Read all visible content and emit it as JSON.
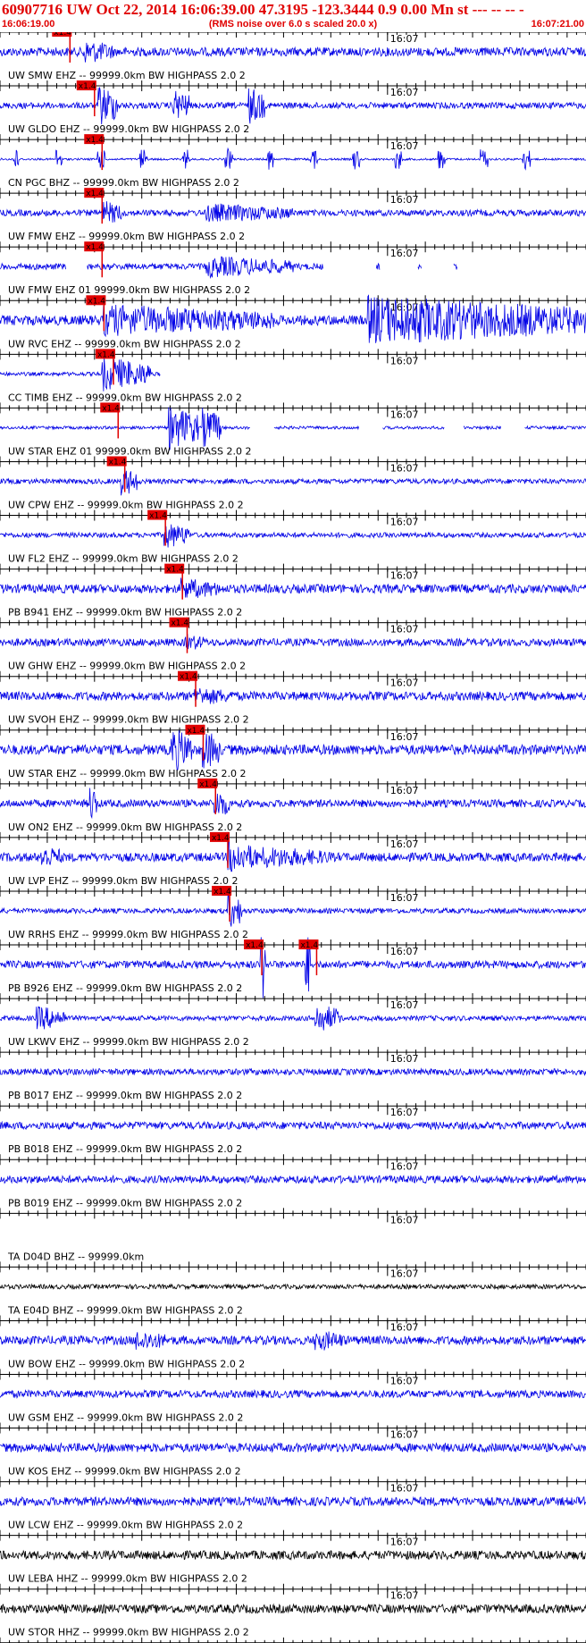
{
  "header": {
    "title": "60907716 UW Oct 22, 2014 16:06:39.00   47.3195 -123.3444  0.9 0.00 Mn st --- -- --  -",
    "start_time": "16:06:19.00",
    "note": "(RMS noise over 6.0 s scaled 20.0 x)",
    "end_time": "16:07:21.00"
  },
  "chart_data": {
    "type": "line",
    "title": "60907716 UW Oct 22, 2014 16:06:39.00   47.3195 -123.3444  0.9 0.00 Mn st --- -- --  -",
    "time_range": [
      "16:06:19.00",
      "16:07:21.00"
    ],
    "minute_tick_label": "16:07",
    "minute_tick_time_s": 41,
    "pick_label": "x1.4",
    "colors": {
      "trace": "#0000e6",
      "trace_alt": "#000000",
      "pick": "#e00000",
      "header": "#e00000"
    },
    "traces": [
      {
        "label": "UW SMW EHZ -- 99999.0km BW  HIGHPASS  2.0  2",
        "color": "#0000e6",
        "amp": 0.35,
        "picks": [
          {
            "t": 7.4
          }
        ],
        "bursts": [
          {
            "t": 9.0,
            "dur": 3,
            "amp": 1.0
          }
        ]
      },
      {
        "label": "UW GLDO EHZ -- 99999.0km BW  HIGHPASS  2.0  2",
        "color": "#0000e6",
        "amp": 0.25,
        "picks": [
          {
            "t": 10.0
          }
        ],
        "bursts": [
          {
            "t": 10.5,
            "dur": 2,
            "amp": 1.7
          },
          {
            "t": 18.5,
            "dur": 1.5,
            "amp": 1.3
          },
          {
            "t": 26.5,
            "dur": 1.5,
            "amp": 1.5
          }
        ]
      },
      {
        "label": "CN PGC BHZ -- 99999.0km BW  HIGHPASS  2.0  2",
        "color": "#0000e6",
        "amp": 0.08,
        "picks": [
          {
            "t": 10.8
          }
        ],
        "bursts": [
          {
            "t": 1.5,
            "dur": 0.6,
            "amp": 0.9
          },
          {
            "t": 6,
            "dur": 0.6,
            "amp": 0.9
          },
          {
            "t": 10.5,
            "dur": 0.6,
            "amp": 0.9
          },
          {
            "t": 15,
            "dur": 0.6,
            "amp": 0.9
          },
          {
            "t": 19.5,
            "dur": 0.6,
            "amp": 0.9
          },
          {
            "t": 24,
            "dur": 0.6,
            "amp": 0.9
          },
          {
            "t": 28.5,
            "dur": 0.6,
            "amp": 0.9
          },
          {
            "t": 33,
            "dur": 0.6,
            "amp": 0.9
          },
          {
            "t": 37.5,
            "dur": 0.6,
            "amp": 0.9
          },
          {
            "t": 42,
            "dur": 0.6,
            "amp": 0.9
          },
          {
            "t": 46.5,
            "dur": 0.6,
            "amp": 0.9
          },
          {
            "t": 51,
            "dur": 0.6,
            "amp": 0.9
          },
          {
            "t": 55.5,
            "dur": 0.6,
            "amp": 0.9
          }
        ]
      },
      {
        "label": "UW FMW EHZ -- 99999.0km BW  HIGHPASS  2.0  2",
        "color": "#0000e6",
        "amp": 0.25,
        "picks": [
          {
            "t": 10.8
          }
        ],
        "bursts": [
          {
            "t": 11,
            "dur": 2,
            "amp": 1.0
          },
          {
            "t": 22,
            "dur": 9,
            "amp": 0.8
          }
        ],
        "gaps": []
      },
      {
        "label": "UW FMW EHZ 01 99999.0km BW  HIGHPASS  2.0  2",
        "color": "#0000e6",
        "amp": 0.25,
        "picks": [
          {
            "t": 10.8
          }
        ],
        "bursts": [
          {
            "t": 22,
            "dur": 9,
            "amp": 0.9
          }
        ],
        "gaps": [
          [
            7,
            9.2
          ],
          [
            34.2,
            39.8
          ],
          [
            40.2,
            44.2
          ],
          [
            44.6,
            48.0
          ],
          [
            48.4,
            62
          ]
        ]
      },
      {
        "label": "UW RVC EHZ -- 99999.0km BW  HIGHPASS  2.0  2",
        "color": "#0000e6",
        "amp": 0.4,
        "picks": [
          {
            "t": 11.0
          }
        ],
        "bursts": [
          {
            "t": 11,
            "dur": 18,
            "amp": 1.3
          },
          {
            "t": 39,
            "dur": 23,
            "amp": 2.0
          }
        ]
      },
      {
        "label": "CC TIMB EHZ -- 99999.0km BW  HIGHPASS  2.0  2",
        "color": "#0000e6",
        "amp": 0.15,
        "picks": [
          {
            "t": 12.0
          }
        ],
        "bursts": [
          {
            "t": 11,
            "dur": 5,
            "amp": 1.4
          }
        ],
        "gaps": [
          [
            17,
            62
          ]
        ]
      },
      {
        "label": "UW STAR EHZ 01 99999.0km BW  HIGHPASS  2.0  2",
        "color": "#0000e6",
        "amp": 0.12,
        "picks": [
          {
            "t": 12.5
          }
        ],
        "bursts": [
          {
            "t": 18,
            "dur": 3,
            "amp": 1.8
          },
          {
            "t": 21.5,
            "dur": 2,
            "amp": 1.6
          }
        ],
        "gaps": [
          [
            26.5,
            29
          ],
          [
            38,
            40.5
          ],
          [
            47,
            49
          ],
          [
            53,
            55.5
          ]
        ]
      },
      {
        "label": "UW CPW EHZ -- 99999.0km BW  HIGHPASS  2.0  2",
        "color": "#0000e6",
        "amp": 0.2,
        "picks": [
          {
            "t": 13.2
          }
        ],
        "bursts": [
          {
            "t": 13,
            "dur": 1.5,
            "amp": 1.2
          }
        ]
      },
      {
        "label": "UW FL2 EHZ -- 99999.0km BW  HIGHPASS  2.0  2",
        "color": "#0000e6",
        "amp": 0.2,
        "picks": [
          {
            "t": 17.5
          }
        ],
        "bursts": [
          {
            "t": 17.5,
            "dur": 2.5,
            "amp": 1.1
          }
        ]
      },
      {
        "label": "PB B941 EHZ -- 99999.0km BW  HIGHPASS  2.0  2",
        "color": "#0000e6",
        "amp": 0.35,
        "picks": [
          {
            "t": 19.3
          }
        ],
        "bursts": [
          {
            "t": 19.3,
            "dur": 4,
            "amp": 0.9
          }
        ]
      },
      {
        "label": "UW GHW EHZ -- 99999.0km BW  HIGHPASS  2.0  2",
        "color": "#0000e6",
        "amp": 0.3,
        "picks": [
          {
            "t": 19.8
          }
        ],
        "bursts": [
          {
            "t": 19.8,
            "dur": 2,
            "amp": 0.7
          }
        ]
      },
      {
        "label": "UW SVOH EHZ -- 99999.0km BW  HIGHPASS  2.0  2",
        "color": "#0000e6",
        "amp": 0.35,
        "picks": [
          {
            "t": 20.7
          }
        ],
        "bursts": [
          {
            "t": 20.7,
            "dur": 4,
            "amp": 0.8
          }
        ]
      },
      {
        "label": "UW STAR EHZ -- 99999.0km BW  HIGHPASS  2.0  2",
        "color": "#0000e6",
        "amp": 0.4,
        "picks": [
          {
            "t": 21.5
          }
        ],
        "bursts": [
          {
            "t": 18.3,
            "dur": 2,
            "amp": 1.8
          },
          {
            "t": 21.6,
            "dur": 1.8,
            "amp": 1.6
          }
        ]
      },
      {
        "label": "UW ON2 EHZ -- 99999.0km BW  HIGHPASS  2.0  2",
        "color": "#0000e6",
        "amp": 0.3,
        "picks": [
          {
            "t": 22.8
          }
        ],
        "bursts": [
          {
            "t": 9.6,
            "dur": 0.6,
            "amp": 1.5
          },
          {
            "t": 22.8,
            "dur": 1.5,
            "amp": 1.2
          }
        ]
      },
      {
        "label": "UW LVP EHZ -- 99999.0km BW  HIGHPASS  2.0  2",
        "color": "#0000e6",
        "amp": 0.35,
        "picks": [
          {
            "t": 24.1
          }
        ],
        "bursts": [
          {
            "t": 4.5,
            "dur": 2,
            "amp": 1.0
          },
          {
            "t": 24.3,
            "dur": 3,
            "amp": 1.4
          },
          {
            "t": 28,
            "dur": 7,
            "amp": 0.9
          }
        ]
      },
      {
        "label": "UW RRHS EHZ -- 99999.0km BW  HIGHPASS  2.0  2",
        "color": "#0000e6",
        "amp": 0.2,
        "picks": [
          {
            "t": 24.3
          }
        ],
        "bursts": [
          {
            "t": 24.3,
            "dur": 1.5,
            "amp": 1.4
          }
        ]
      },
      {
        "label": "PB B926 EHZ -- 99999.0km BW  HIGHPASS  2.0  2",
        "color": "#0000e6",
        "amp": 0.3,
        "picks": [
          {
            "t": 27.7
          },
          {
            "t": 33.5
          }
        ],
        "bursts": [
          {
            "t": 27.7,
            "dur": 0.4,
            "amp": 3.0
          },
          {
            "t": 32.5,
            "dur": 0.4,
            "amp": 2.5
          }
        ]
      },
      {
        "label": "UW LKWV EHZ -- 99999.0km BW  HIGHPASS  2.0  2",
        "color": "#0000e6",
        "amp": 0.2,
        "picks": [],
        "bursts": [
          {
            "t": 4,
            "dur": 3,
            "amp": 1.0
          },
          {
            "t": 33.5,
            "dur": 2.5,
            "amp": 1.2
          }
        ]
      },
      {
        "label": "PB B017 EHZ -- 99999.0km BW  HIGHPASS  2.0  2",
        "color": "#0000e6",
        "amp": 0.25,
        "picks": [],
        "bursts": []
      },
      {
        "label": "PB B018 EHZ -- 99999.0km BW  HIGHPASS  2.0  2",
        "color": "#0000e6",
        "amp": 0.3,
        "picks": [],
        "bursts": []
      },
      {
        "label": "PB B019 EHZ -- 99999.0km BW  HIGHPASS  2.0  2",
        "color": "#0000e6",
        "amp": 0.3,
        "picks": [],
        "bursts": []
      },
      {
        "label": "TA D04D BHZ -- 99999.0km",
        "color": "#0000e6",
        "amp": 0.0,
        "picks": [],
        "bursts": []
      },
      {
        "label": "TA E04D BHZ -- 99999.0km BW  HIGHPASS  2.0  2",
        "color": "#000000",
        "amp": 0.18,
        "picks": [],
        "bursts": []
      },
      {
        "label": "UW BOW EHZ -- 99999.0km BW  HIGHPASS  2.0  2",
        "color": "#0000e6",
        "amp": 0.35,
        "picks": [],
        "bursts": [
          {
            "t": 14.5,
            "dur": 3,
            "amp": 0.9
          },
          {
            "t": 33.5,
            "dur": 3,
            "amp": 0.9
          }
        ]
      },
      {
        "label": "UW GSM EHZ -- 99999.0km BW  HIGHPASS  2.0  2",
        "color": "#0000e6",
        "amp": 0.3,
        "picks": [],
        "bursts": []
      },
      {
        "label": "UW KOS EHZ -- 99999.0km BW  HIGHPASS  2.0  2",
        "color": "#0000e6",
        "amp": 0.35,
        "picks": [],
        "bursts": []
      },
      {
        "label": "UW LCW EHZ -- 99999.0km BW  HIGHPASS  2.0  2",
        "color": "#0000e6",
        "amp": 0.35,
        "picks": [],
        "bursts": []
      },
      {
        "label": "UW LEBA HHZ -- 99999.0km BW  HIGHPASS  2.0  2",
        "color": "#000000",
        "amp": 0.35,
        "picks": [],
        "bursts": []
      },
      {
        "label": "UW STOR HHZ -- 99999.0km BW  HIGHPASS  2.0  2",
        "color": "#000000",
        "amp": 0.35,
        "picks": [],
        "bursts": []
      },
      {
        "label": "",
        "color": "#000000",
        "amp": 0.35,
        "picks": [],
        "bursts": []
      }
    ]
  }
}
